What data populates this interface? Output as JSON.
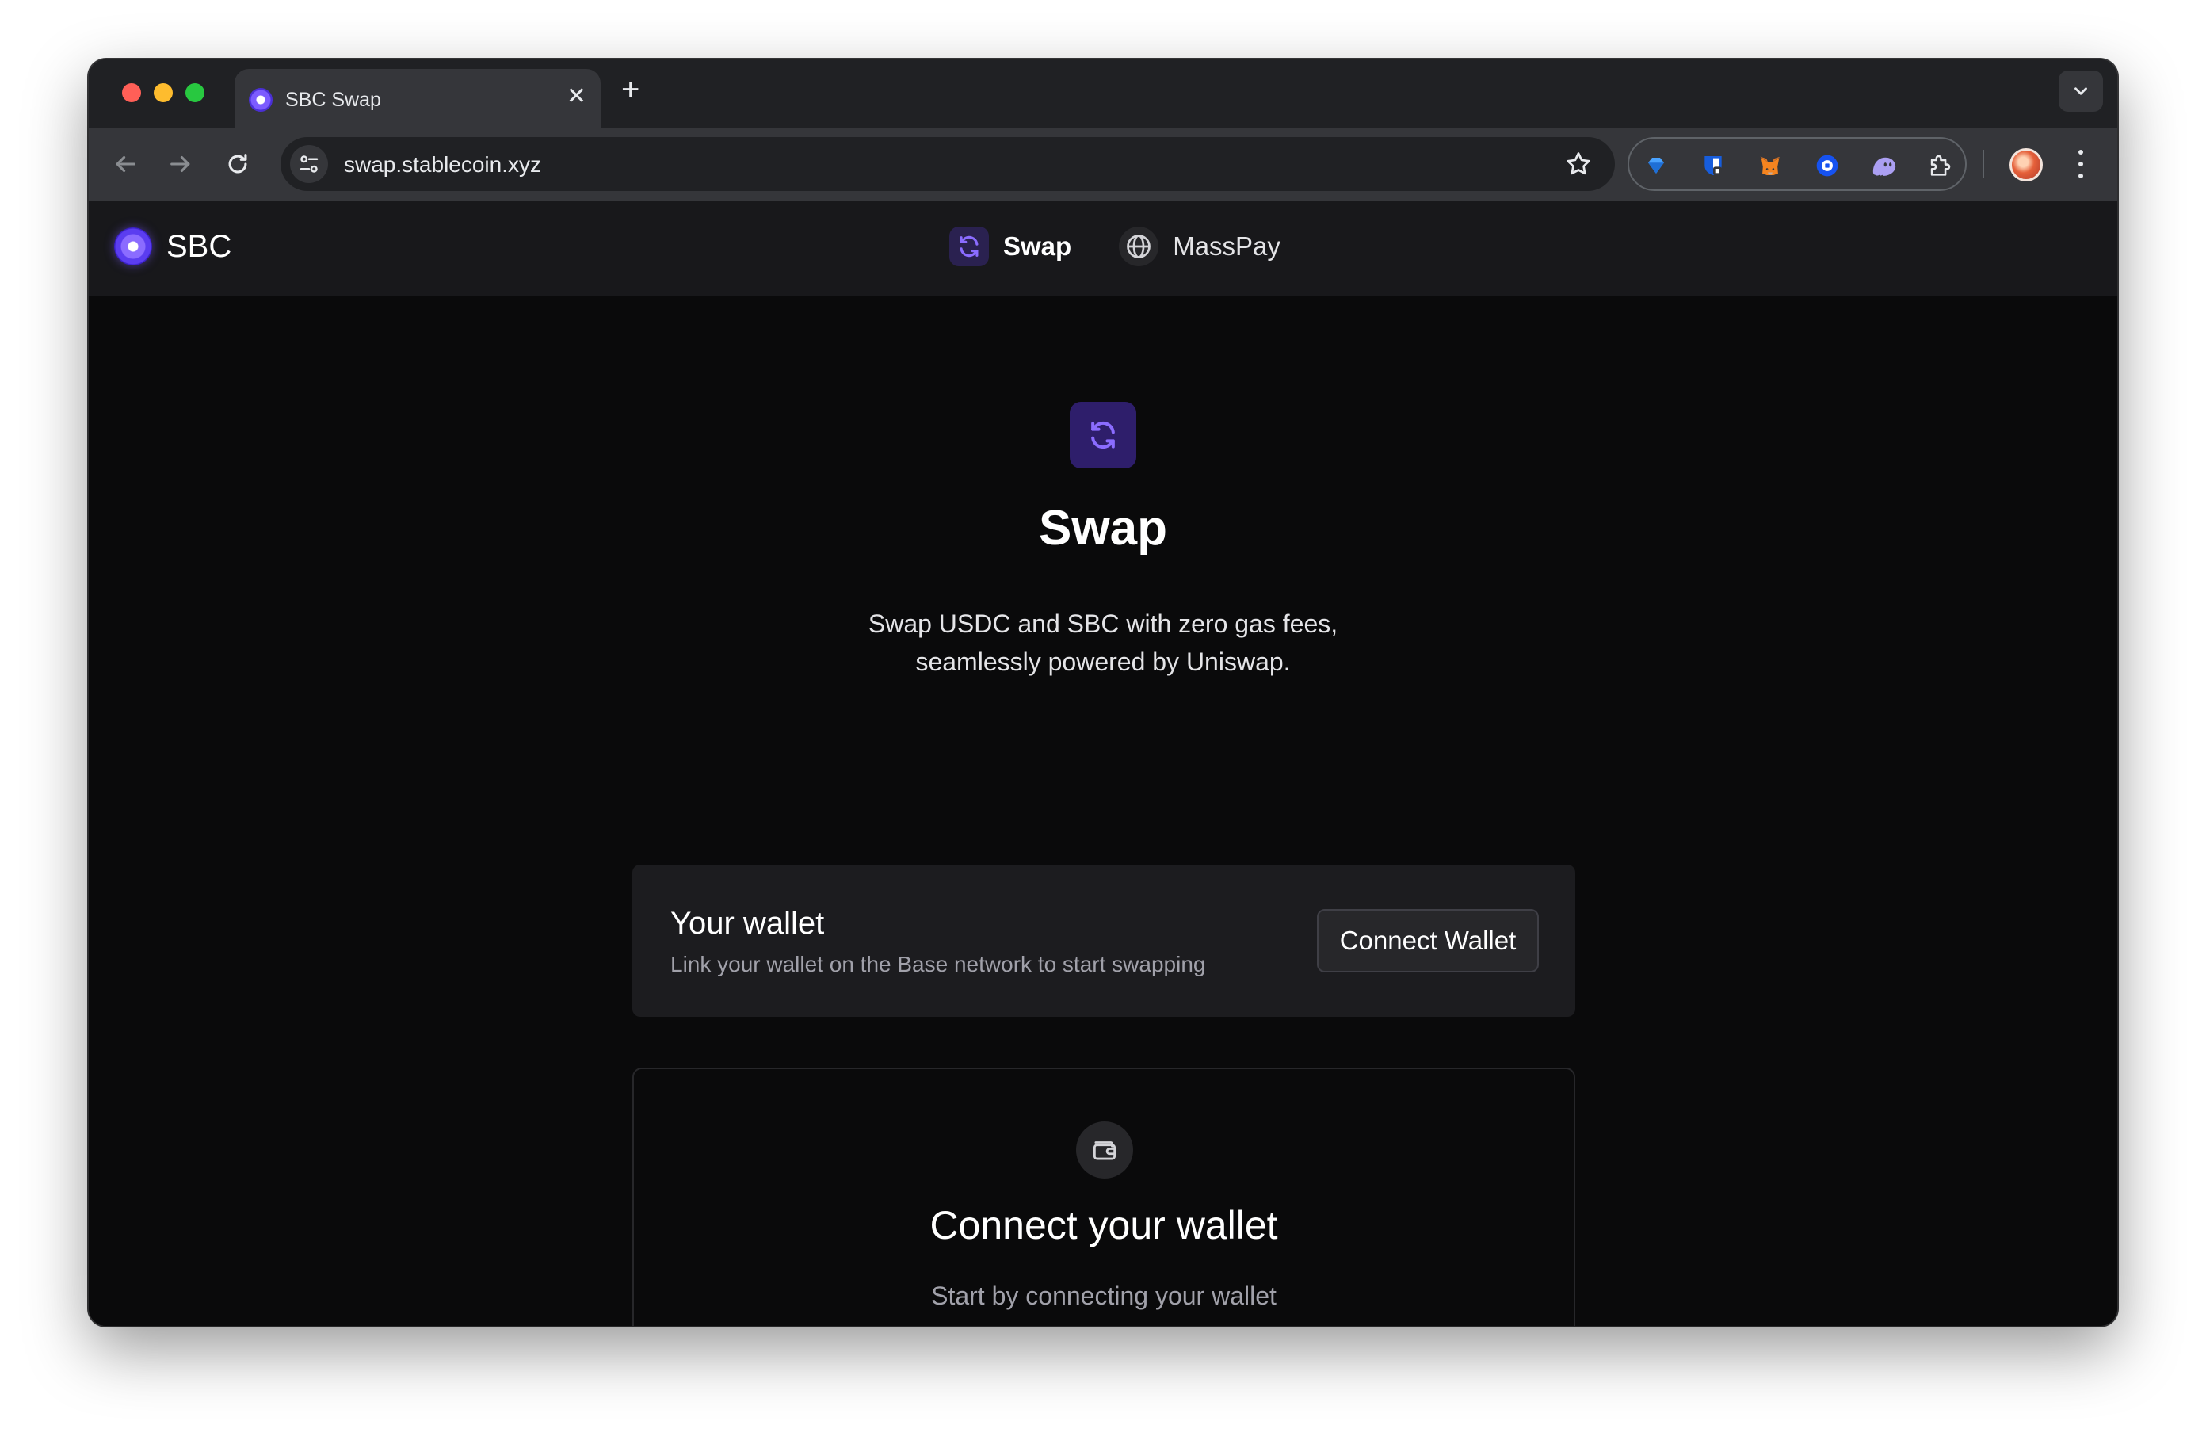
{
  "browser": {
    "tab_title": "SBC Swap",
    "tab_close": "✕",
    "new_tab": "+",
    "url": "swap.stablecoin.xyz",
    "extensions": [
      "gem-extension-icon",
      "bitwarden-icon",
      "metamask-icon",
      "coinbase-wallet-icon",
      "phantom-icon",
      "puzzle-extensions-icon"
    ]
  },
  "app": {
    "brand_name": "SBC",
    "nav": [
      {
        "label": "Swap",
        "icon": "swap-arrows-icon",
        "active": true
      },
      {
        "label": "MassPay",
        "icon": "globe-icon",
        "active": false
      }
    ],
    "accent_color": "#7c5cff"
  },
  "hero": {
    "title": "Swap",
    "subtitle_line1": "Swap USDC and SBC with zero gas fees,",
    "subtitle_line2": "seamlessly powered by Uniswap."
  },
  "wallet_card": {
    "title": "Your wallet",
    "description": "Link your wallet on the Base network to start swapping",
    "button_label": "Connect Wallet"
  },
  "connect_card": {
    "title": "Connect your wallet",
    "subtitle": "Start by connecting your wallet"
  }
}
